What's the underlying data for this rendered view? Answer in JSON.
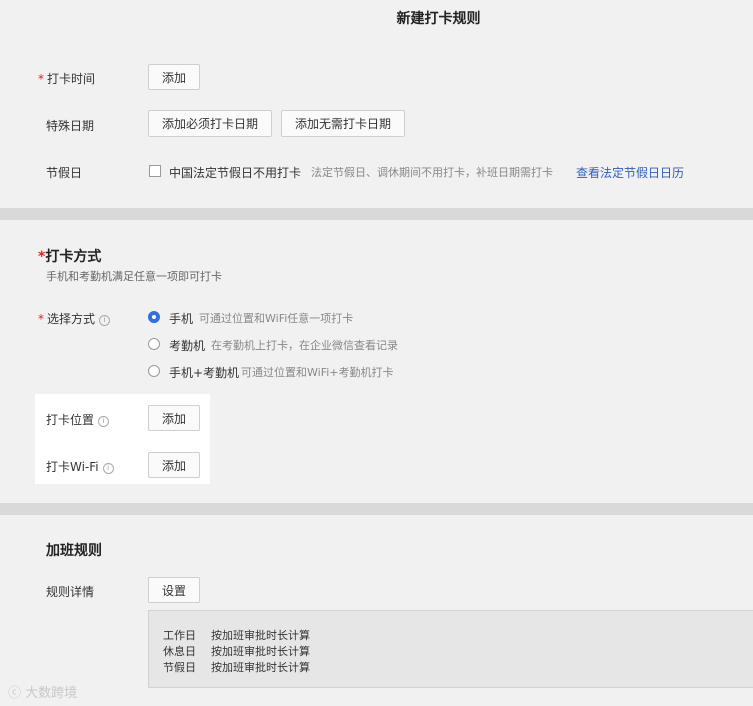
{
  "page_title": "新建打卡规则",
  "checkin_time": {
    "label": "打卡时间",
    "add_button": "添加"
  },
  "special_dates": {
    "label": "特殊日期",
    "add_required": "添加必须打卡日期",
    "add_not_required": "添加无需打卡日期"
  },
  "holidays": {
    "label": "节假日",
    "checkbox_label": "中国法定节假日不用打卡",
    "hint": "法定节假日、调休期间不用打卡，补班日期需打卡",
    "calendar_link": "查看法定节假日日历"
  },
  "method": {
    "title": "打卡方式",
    "subtitle": "手机和考勤机满足任意一项即可打卡",
    "select_label": "选择方式",
    "options": [
      {
        "name": "手机",
        "desc": "可通过位置和WiFi任意一项打卡",
        "selected": true
      },
      {
        "name": "考勤机",
        "desc": "在考勤机上打卡，在企业微信查看记录",
        "selected": false
      },
      {
        "name": "手机+考勤机",
        "desc": "可通过位置和WiFi+考勤机打卡",
        "selected": false
      }
    ],
    "location_label": "打卡位置",
    "location_add": "添加",
    "wifi_label": "打卡Wi-Fi",
    "wifi_add": "添加"
  },
  "overtime": {
    "title": "加班规则",
    "detail_label": "规则详情",
    "settings_button": "设置",
    "rules": [
      {
        "day": "工作日",
        "rule": "按加班审批时长计算"
      },
      {
        "day": "休息日",
        "rule": "按加班审批时长计算"
      },
      {
        "day": "节假日",
        "rule": "按加班审批时长计算"
      }
    ]
  },
  "watermark": "大数跨境",
  "colors": {
    "accent": "#2f6fe0",
    "link": "#2f5fbf",
    "required": "#e02020",
    "divider": "#d9d9d9"
  }
}
